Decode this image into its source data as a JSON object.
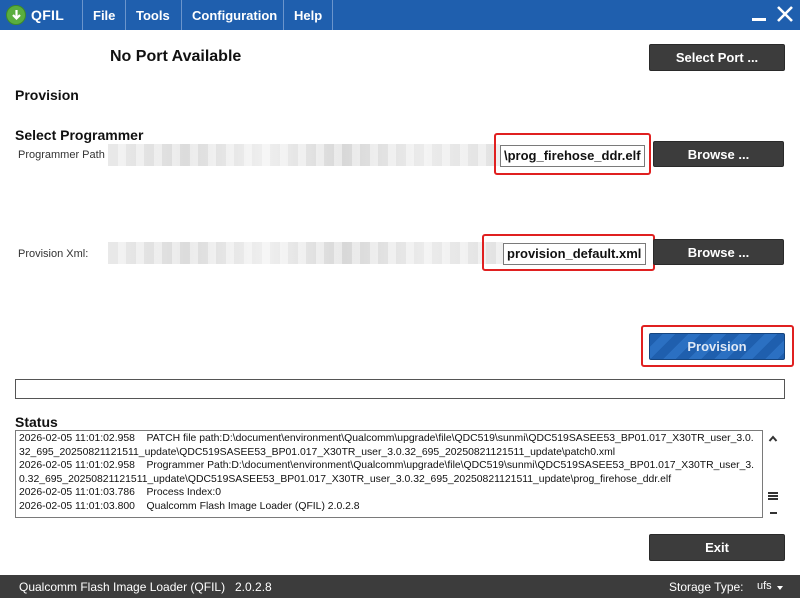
{
  "app": {
    "title": "QFIL",
    "menu": [
      "File",
      "Tools",
      "Configuration",
      "Help"
    ]
  },
  "port": {
    "status": "No Port Available",
    "select_button": "Select Port ..."
  },
  "provision": {
    "heading": "Provision",
    "select_programmer_heading": "Select Programmer",
    "programmer_path_label": "Programmer Path",
    "programmer_path_value": "\\prog_firehose_ddr.elf",
    "provision_xml_label": "Provision Xml:",
    "provision_xml_value": "provision_default.xml",
    "browse_label": "Browse ...",
    "provision_button": "Provision"
  },
  "progress": {
    "fraction": 0
  },
  "status": {
    "heading": "Status",
    "log": [
      "2026-02-05 11:01:02.958    PATCH file path:D:\\document\\environment\\Qualcomm\\upgrade\\file\\QDC519\\sunmi\\QDC519SASEE53_BP01.017_X30TR_user_3.0.32_695_20250821121511_update\\QDC519SASEE53_BP01.017_X30TR_user_3.0.32_695_20250821121511_update\\patch0.xml",
      "2026-02-05 11:01:02.958    Programmer Path:D:\\document\\environment\\Qualcomm\\upgrade\\file\\QDC519\\sunmi\\QDC519SASEE53_BP01.017_X30TR_user_3.0.32_695_20250821121511_update\\QDC519SASEE53_BP01.017_X30TR_user_3.0.32_695_20250821121511_update\\prog_firehose_ddr.elf",
      "2026-02-05 11:01:03.786    Process Index:0",
      "2026-02-05 11:01:03.800    Qualcomm Flash Image Loader (QFIL) 2.0.2.8"
    ]
  },
  "exit_button": "Exit",
  "statusbar": {
    "app_name": "Qualcomm Flash Image Loader (QFIL)",
    "version": "2.0.2.8",
    "storage_type_label": "Storage Type:",
    "storage_type_value": "ufs"
  },
  "colors": {
    "accent": "#1f5fae",
    "dark_button": "#3c3c3c",
    "highlight": "#e02020"
  },
  "icons": [
    "download-arrow-icon",
    "minimize-icon",
    "close-icon",
    "scroll-up-icon",
    "scroll-thumb-icon",
    "scroll-down-icon",
    "chevron-down-icon"
  ]
}
